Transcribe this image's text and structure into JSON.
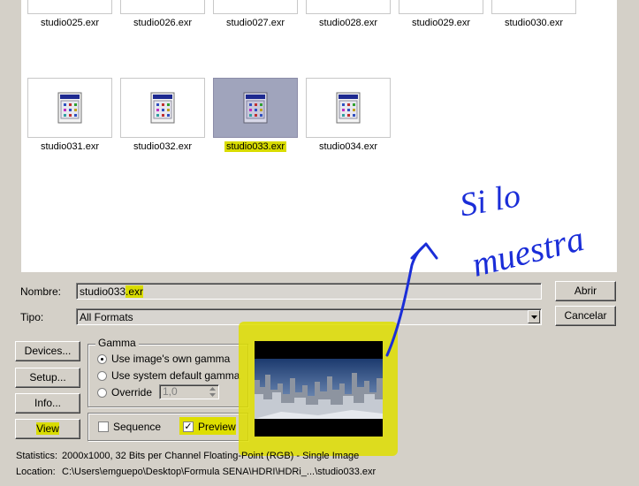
{
  "files_row1": [
    "studio025.exr",
    "studio026.exr",
    "studio027.exr",
    "studio028.exr",
    "studio029.exr",
    "studio030.exr"
  ],
  "files_row2": [
    "studio031.exr",
    "studio032.exr",
    "studio033.exr",
    "studio034.exr"
  ],
  "selected_file": "studio033.exr",
  "form": {
    "name_label": "Nombre:",
    "name_value": "studio033",
    "name_ext": ".exr",
    "type_label": "Tipo:",
    "type_value": "All Formats"
  },
  "buttons": {
    "open": "Abrir",
    "cancel": "Cancelar",
    "devices": "Devices...",
    "setup": "Setup...",
    "info": "Info...",
    "view": "View"
  },
  "gamma": {
    "title": "Gamma",
    "opt1": "Use image's own gamma",
    "opt2": "Use system default gamma",
    "opt3": "Override",
    "override_value": "1,0"
  },
  "options": {
    "sequence": "Sequence",
    "preview": "Preview"
  },
  "status": {
    "stats_label": "Statistics:",
    "stats_value": "2000x1000, 32 Bits per Channel Floating-Point (RGB) - Single Image",
    "loc_label": "Location:",
    "loc_value": "C:\\Users\\emguepo\\Desktop\\Formula SENA\\HDRI\\HDRi_...\\studio033.exr"
  },
  "annotation": {
    "line1": "Si lo",
    "line2": "muestra"
  },
  "colors": {
    "highlight": "#d9dc00",
    "ink": "#1a2dd8"
  }
}
